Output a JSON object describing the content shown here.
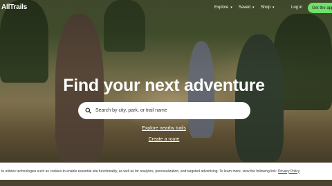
{
  "brand": {
    "logo_text": "AllTrails"
  },
  "nav": {
    "items": [
      {
        "label": "Explore"
      },
      {
        "label": "Saved"
      },
      {
        "label": "Shop"
      }
    ],
    "login_label": "Log in",
    "cta_label": "Get the app"
  },
  "hero": {
    "headline": "Find your next adventure",
    "search_placeholder": "Search by city, park, or trail name",
    "links": [
      {
        "label": "Explore nearby trails"
      },
      {
        "label": "Create a route"
      }
    ]
  },
  "cookie_banner": {
    "text": "te utilizes technologies such as cookies to enable essential site functionality, as well as for analytics, personalization, and targeted advertising. To learn more, view the following link:",
    "link_label": "Privacy Policy"
  },
  "colors": {
    "cta_green": "#6fe06a",
    "headline_white": "#ffffff"
  },
  "icons": {
    "search": "search-icon",
    "chevron": "chevron-down-icon"
  }
}
